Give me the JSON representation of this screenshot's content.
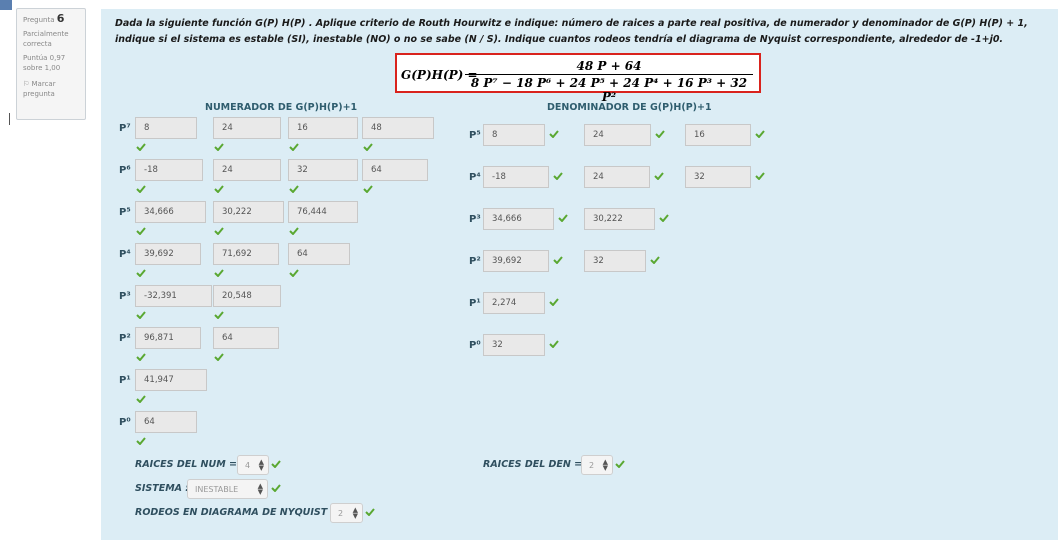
{
  "question": {
    "label": "Pregunta",
    "number": "6",
    "status": "Parcialmente correcta",
    "score": "Puntúa 0,97 sobre 1,00",
    "flag": "Marcar pregunta",
    "flag_icon": "flag-icon"
  },
  "question_text": "Dada la siguiente función G(P) H(P) . Aplique criterio de Routh Hourwitz e indique:  número de raices a parte real positiva, de numerador y denominador de G(P) H(P) + 1, indique si el sistema es estable (SI), inestable (NO) o no se sabe (N / S). Indique cuantos rodeos tendría el diagrama de Nyquist correspondiente, alrededor de  -1+j0.",
  "formula": {
    "lhs": "G(P)H(P) =",
    "numerator": "48 P + 64",
    "denominator": "8 P⁷ − 18 P⁶ + 24 P⁵ + 24 P⁴ + 16 P³ + 32 P²"
  },
  "numerator": {
    "header": "NUMERADOR DE G(P)H(P)+1",
    "rows": [
      {
        "label": "P⁷",
        "values": [
          "8",
          "24",
          "16",
          "48"
        ]
      },
      {
        "label": "P⁶",
        "values": [
          "-18",
          "24",
          "32",
          "64"
        ]
      },
      {
        "label": "P⁵",
        "values": [
          "34,666",
          "30,222",
          "76,444"
        ]
      },
      {
        "label": "P⁴",
        "values": [
          "39,692",
          "71,692",
          "64"
        ]
      },
      {
        "label": "P³",
        "values": [
          "-32,391",
          "20,548"
        ]
      },
      {
        "label": "P²",
        "values": [
          "96,871",
          "64"
        ]
      },
      {
        "label": "P¹",
        "values": [
          "41,947"
        ]
      },
      {
        "label": "P⁰",
        "values": [
          "64"
        ]
      }
    ]
  },
  "denominator": {
    "header": "DENOMINADOR DE G(P)H(P)+1",
    "rows": [
      {
        "label": "P⁵",
        "values": [
          "8",
          "24",
          "16"
        ]
      },
      {
        "label": "P⁴",
        "values": [
          "-18",
          "24",
          "32"
        ]
      },
      {
        "label": "P³",
        "values": [
          "34,666",
          "30,222"
        ]
      },
      {
        "label": "P²",
        "values": [
          "39,692",
          "32"
        ]
      },
      {
        "label": "P¹",
        "values": [
          "2,274"
        ]
      },
      {
        "label": "P⁰",
        "values": [
          "32"
        ]
      }
    ]
  },
  "answers": {
    "raices_num_label": "RAICES DEL NUM =",
    "raices_num_value": "4",
    "raices_den_label": "RAICES DEL DEN =",
    "raices_den_value": "2",
    "sistema_label": "SISTEMA :",
    "sistema_value": "INESTABLE",
    "rodeos_label": "RODEOS EN DIAGRAMA DE NYQUIST :",
    "rodeos_value": "2"
  },
  "colors": {
    "correct": "#5aa832",
    "panel": "#dcedf5",
    "formula_border": "#d9231d"
  }
}
